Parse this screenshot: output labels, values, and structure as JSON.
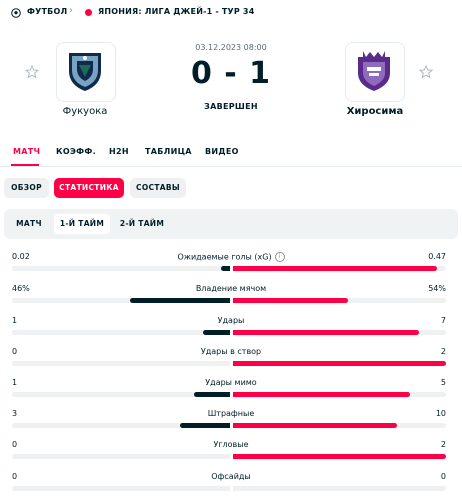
{
  "breadcrumb": {
    "sport": "ФУТБОЛ",
    "league": "ЯПОНИЯ: ЛИГА ДЖЕЙ-1 - ТУР 34"
  },
  "match": {
    "datetime": "03.12.2023 08:00",
    "score": "0 - 1",
    "status": "ЗАВЕРШЕН",
    "home": {
      "name": "Фукуока"
    },
    "away": {
      "name": "Хиросима"
    }
  },
  "tabs": [
    "МАТЧ",
    "КОЭФФ.",
    "H2H",
    "ТАБЛИЦА",
    "ВИДЕО"
  ],
  "subtabs": [
    "ОБЗОР",
    "СТАТИСТИКА",
    "СОСТАВЫ"
  ],
  "periods": [
    "МАТЧ",
    "1-Й ТАЙМ",
    "2-Й ТАЙМ"
  ],
  "colors": {
    "accent": "#ff0046",
    "home_bar": "#001e28",
    "track": "#eef0f1"
  },
  "stats": [
    {
      "label": "Ожидаемые голы (xG)",
      "home": "0.02",
      "away": "0.47",
      "home_share": 0.04,
      "away_share": 0.96,
      "info": true
    },
    {
      "label": "Владение мячом",
      "home": "46%",
      "away": "54%",
      "home_share": 0.46,
      "away_share": 0.54
    },
    {
      "label": "Удары",
      "home": "1",
      "away": "7",
      "home_share": 0.125,
      "away_share": 0.875
    },
    {
      "label": "Удары в створ",
      "home": "0",
      "away": "2",
      "home_share": 0,
      "away_share": 1
    },
    {
      "label": "Удары мимо",
      "home": "1",
      "away": "5",
      "home_share": 0.167,
      "away_share": 0.833
    },
    {
      "label": "Штрафные",
      "home": "3",
      "away": "10",
      "home_share": 0.231,
      "away_share": 0.769
    },
    {
      "label": "Угловые",
      "home": "0",
      "away": "2",
      "home_share": 0,
      "away_share": 1
    },
    {
      "label": "Офсайды",
      "home": "0",
      "away": "0",
      "home_share": 0,
      "away_share": 0
    }
  ]
}
